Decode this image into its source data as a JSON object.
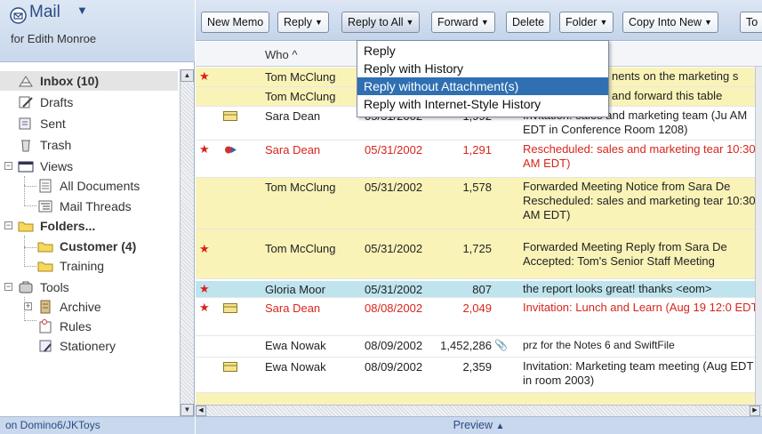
{
  "app": {
    "title": "Mail",
    "user": "for Edith Monroe",
    "server": "on Domino6/JKToys"
  },
  "colors": {
    "accent": "#2a4c86",
    "unread_row": "#faf3b8",
    "highlight_row": "#bfe4ee",
    "red_text": "#d8251d",
    "menu_hover": "#2f6fb2"
  },
  "nav": {
    "inbox": "Inbox (10)",
    "drafts": "Drafts",
    "sent": "Sent",
    "trash": "Trash",
    "views": "Views",
    "all_documents": "All Documents",
    "mail_threads": "Mail Threads",
    "folders": "Folders...",
    "customer": "Customer (4)",
    "training": "Training",
    "tools": "Tools",
    "archive": "Archive",
    "rules": "Rules",
    "stationery": "Stationery"
  },
  "toolbar": {
    "new_memo": "New Memo",
    "reply": "Reply",
    "reply_to_all": "Reply to All",
    "forward": "Forward",
    "delete": "Delete",
    "folder": "Folder",
    "copy_into_new": "Copy Into New",
    "tools": "To"
  },
  "menu": {
    "items": [
      "Reply",
      "Reply with History",
      "Reply without Attachment(s)",
      "Reply with Internet-Style History"
    ],
    "hovered": "Reply without Attachment(s)"
  },
  "view": {
    "col_who": "Who ^",
    "rows": [
      {
        "who": "Tom McClung",
        "date": "",
        "size": "",
        "subject": "nents on the marketing s"
      },
      {
        "who": "Tom McClung",
        "date": "",
        "size": "",
        "subject": "and forward this table"
      },
      {
        "who": "Sara Dean",
        "date": "05/31/2002",
        "size": "1,992",
        "subject": "Invitation: sales and marketing team (Ju AM EDT in Conference Room 1208)"
      },
      {
        "who": "Sara Dean",
        "date": "05/31/2002",
        "size": "1,291",
        "subject": "Rescheduled: sales and marketing tear 10:30 AM EDT)"
      },
      {
        "who": "Tom McClung",
        "date": "05/31/2002",
        "size": "1,578",
        "subject": "Forwarded Meeting Notice from Sara De Rescheduled: sales and marketing tear 10:30 AM EDT)"
      },
      {
        "who": "Tom McClung",
        "date": "05/31/2002",
        "size": "1,725",
        "subject": "Forwarded Meeting Reply from Sara De Accepted: Tom's Senior Staff Meeting"
      },
      {
        "who": "Gloria Moor",
        "date": "05/31/2002",
        "size": "807",
        "subject": "the report looks great!  thanks <eom>"
      },
      {
        "who": "Sara Dean",
        "date": "08/08/2002",
        "size": "2,049",
        "subject": "Invitation: Lunch and Learn (Aug 19 12:0 EDT)"
      },
      {
        "who": "Ewa Nowak",
        "date": "08/09/2002",
        "size": "1,452,286",
        "subject": "prz for the Notes 6 and SwiftFile"
      },
      {
        "who": "Ewa Nowak",
        "date": "08/09/2002",
        "size": "2,359",
        "subject": "Invitation: Marketing team meeting (Aug EDT in room 2003)"
      }
    ]
  },
  "preview": {
    "label": "Preview"
  }
}
